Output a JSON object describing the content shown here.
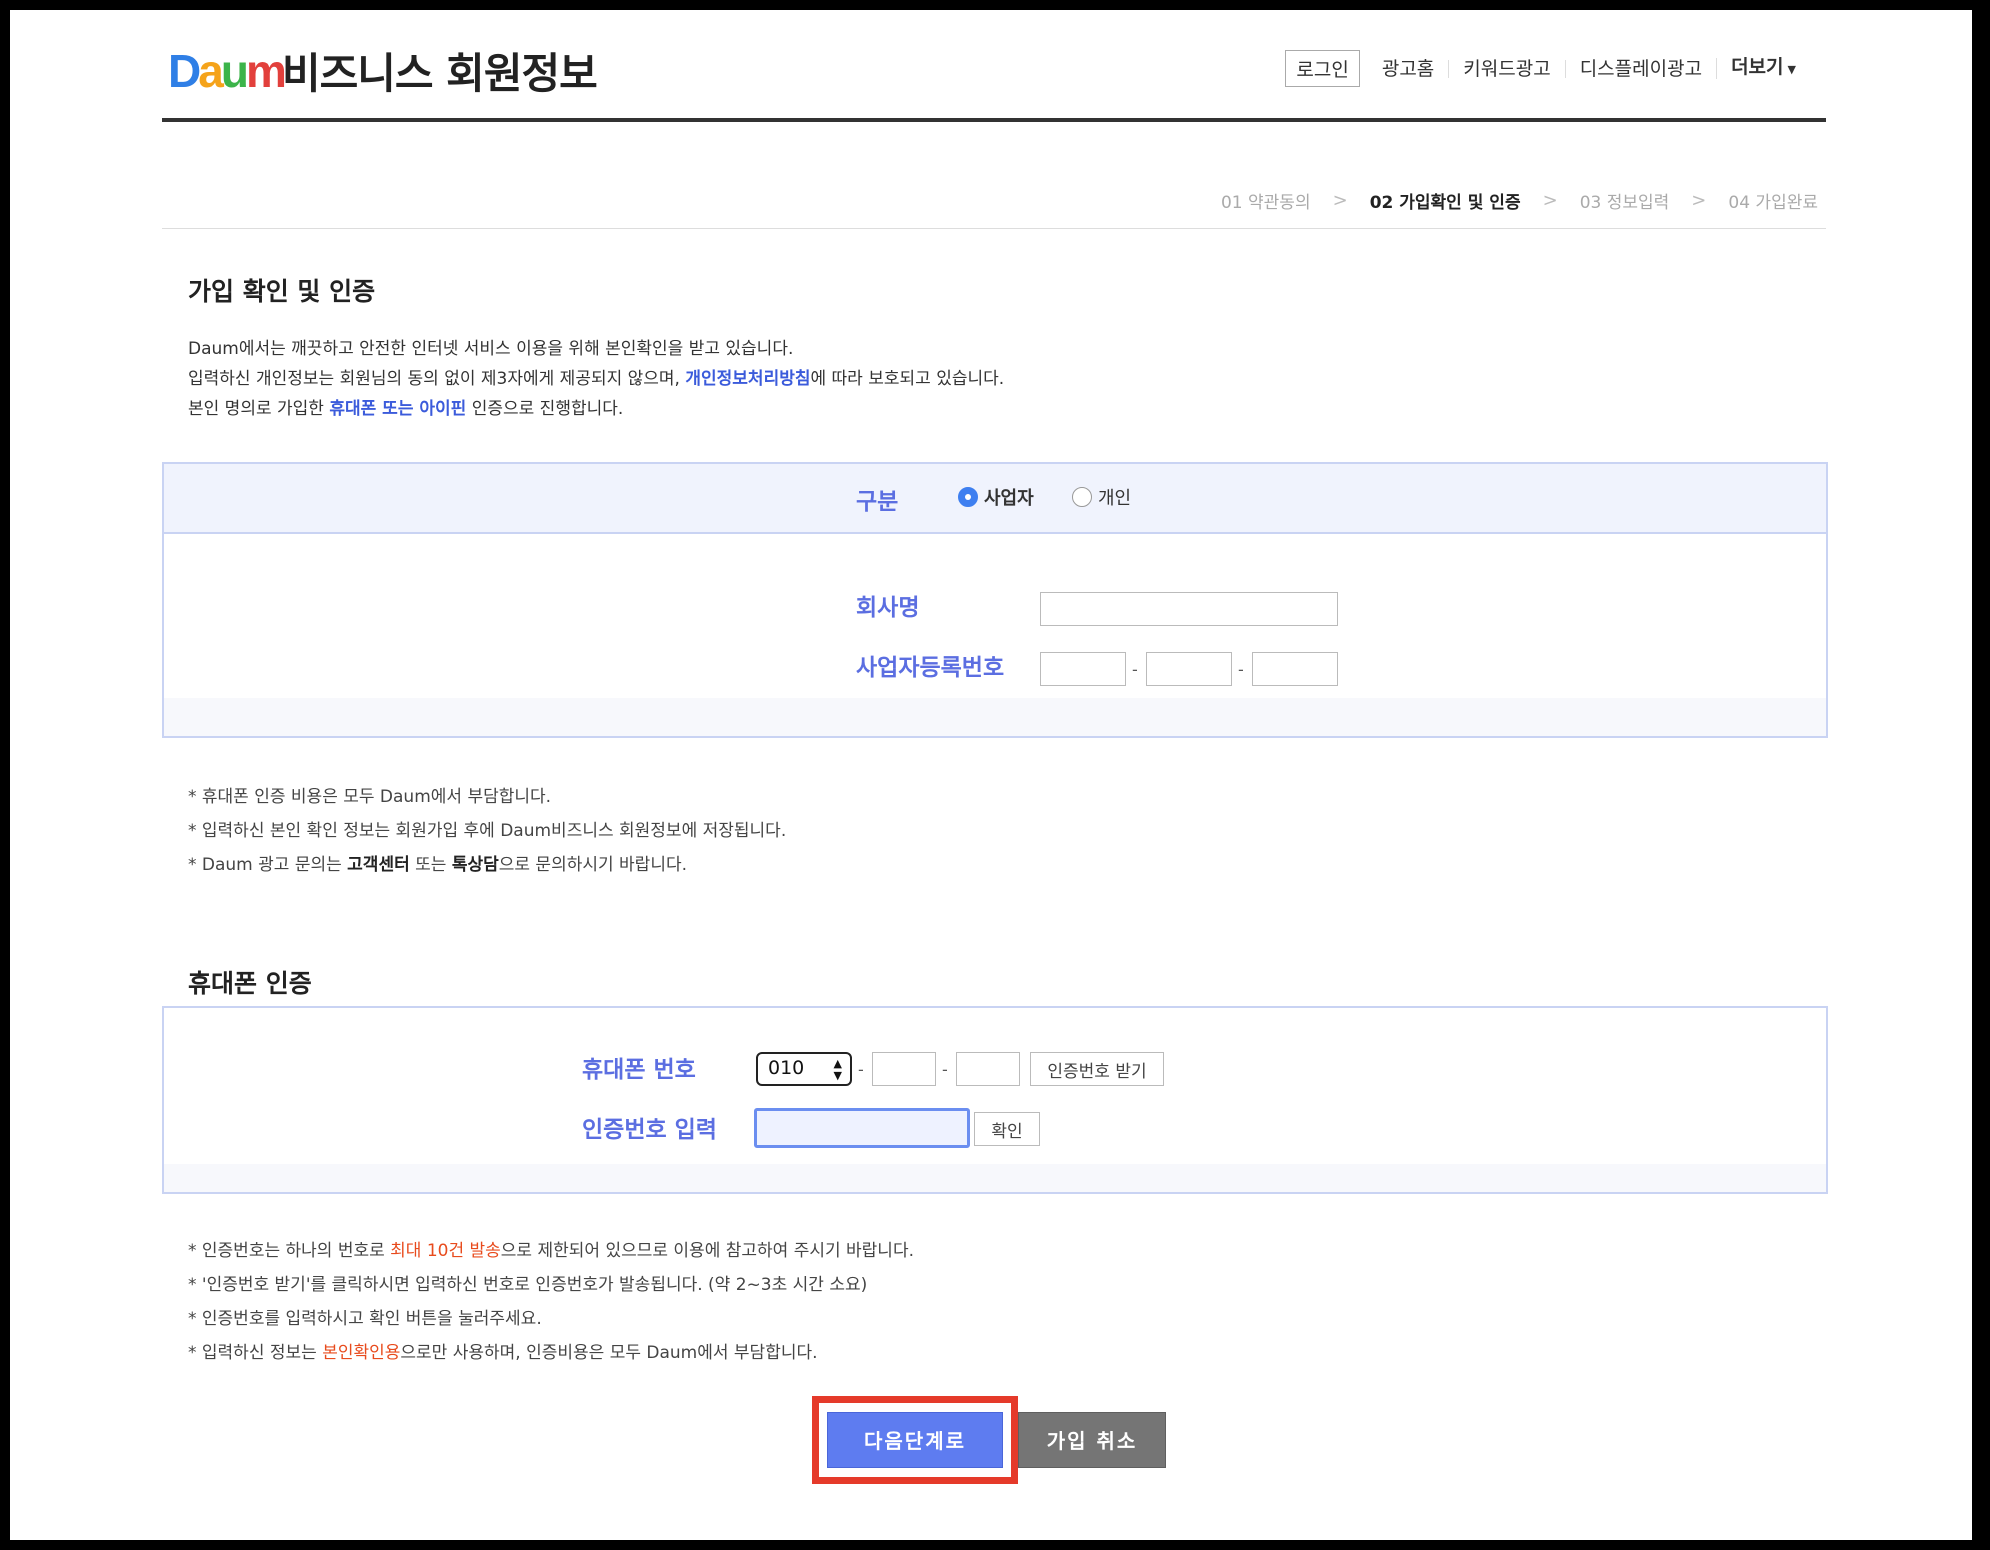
{
  "header": {
    "logo_text": "Daum",
    "service_title": "비즈니스 회원정보",
    "login_label": "로그인",
    "nav": [
      "광고홈",
      "키워드광고",
      "디스플레이광고"
    ],
    "more_label": "더보기"
  },
  "steps": [
    {
      "label": "01 약관동의",
      "active": false
    },
    {
      "label": "02 가입확인 및 인증",
      "active": true
    },
    {
      "label": "03 정보입력",
      "active": false
    },
    {
      "label": "04 가입완료",
      "active": false
    }
  ],
  "verify": {
    "title": "가입 확인  및 인증",
    "desc1": "Daum에서는 깨끗하고 안전한 인터넷 서비스 이용을 위해 본인확인을 받고 있습니다.",
    "desc2_pre": "입력하신 개인정보는 회원님의 동의 없이 제3자에게 제공되지 않으며, ",
    "desc2_link": "개인정보처리방침",
    "desc2_post": "에 따라 보호되고 있습니다.",
    "desc3_pre": "본인 명의로 가입한 ",
    "desc3_link": "휴대폰 또는 아이핀",
    "desc3_post": " 인증으로 진행합니다."
  },
  "form": {
    "type_label": "구분",
    "options": [
      {
        "label": "사업자",
        "selected": true
      },
      {
        "label": "개인",
        "selected": false
      }
    ],
    "company_label": "회사명",
    "company_value": "",
    "bizno_label": "사업자등록번호",
    "dash": "-"
  },
  "notes1": {
    "n1": "* 휴대폰 인증 비용은 모두 Daum에서 부담합니다.",
    "n2": "* 입력하신 본인 확인 정보는 회원가입 후에 Daum비즈니스 회원정보에 저장됩니다.",
    "n3_pre": "* Daum 광고 문의는 ",
    "n3_b1": "고객센터",
    "n3_mid": " 또는 ",
    "n3_b2": "톡상담",
    "n3_post": "으로 문의하시기 바랍니다."
  },
  "phone": {
    "title": "휴대폰 인증",
    "phone_label": "휴대폰 번호",
    "prefix_value": "010",
    "request_button": "인증번호 받기",
    "code_label": "인증번호 입력",
    "confirm_button": "확인"
  },
  "notes2": {
    "n1_pre": "* 인증번호는 하나의 번호로 ",
    "n1_red": "최대 10건 발송",
    "n1_post": "으로 제한되어 있으므로 이용에 참고하여 주시기 바랍니다.",
    "n2": "* '인증번호 받기'를 클릭하시면 입력하신 번호로 인증번호가 발송됩니다. (약 2~3초 시간 소요)",
    "n3": "* 인증번호를 입력하시고 확인 버튼을 눌러주세요.",
    "n4_pre": "* 입력하신 정보는 ",
    "n4_red": "본인확인용",
    "n4_post": "으로만 사용하며, 인증비용은 모두 Daum에서 부담합니다."
  },
  "actions": {
    "next_label": "다음단계로",
    "cancel_label": "가입 취소"
  },
  "colors": {
    "accent": "#5e7cf0",
    "label_blue": "#5b6ee1",
    "highlight_red": "#e53a2a"
  }
}
